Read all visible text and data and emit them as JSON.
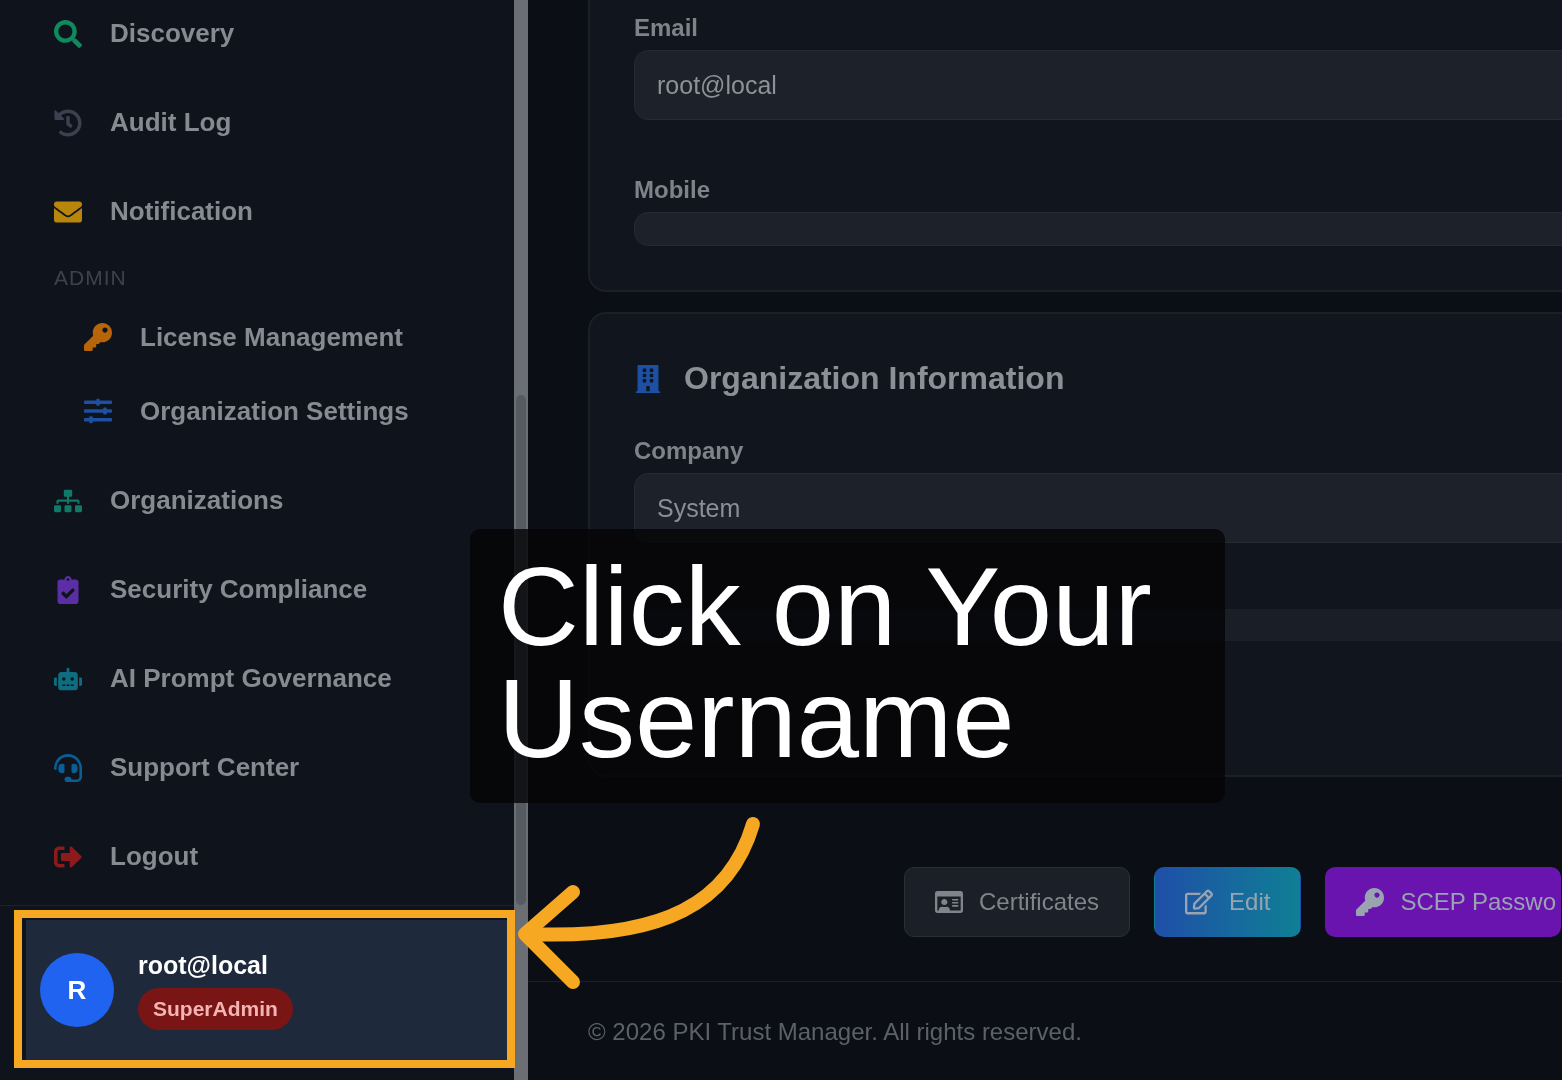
{
  "sidebar": {
    "items": [
      {
        "label": "Discovery",
        "color": "#0f8a5f"
      },
      {
        "label": "Audit Log",
        "color": "#3a4250"
      },
      {
        "label": "Notification",
        "color": "#b8860b"
      }
    ],
    "section": {
      "title": "ADMIN",
      "items": [
        {
          "label": "License Management",
          "color": "#b8650a"
        },
        {
          "label": "Organization Settings",
          "color": "#1d4fa3"
        }
      ]
    },
    "items_after": [
      {
        "label": "Organizations",
        "color": "#0f7a6a"
      },
      {
        "label": "Security Compliance",
        "color": "#5b2ea6"
      },
      {
        "label": "AI Prompt Governance",
        "color": "#0e6e80"
      },
      {
        "label": "Support Center",
        "color": "#0b5e94"
      },
      {
        "label": "Logout",
        "color": "#8e1b1b"
      }
    ],
    "user": {
      "avatar": "R",
      "name": "root@local",
      "role": "SuperAdmin"
    }
  },
  "contact_card": {
    "fields": [
      {
        "label": "Email",
        "value": "root@local"
      },
      {
        "label": "Mobile"
      }
    ]
  },
  "organization_card": {
    "title": "Organization Information",
    "fields": [
      {
        "label": "Company",
        "value": "System"
      }
    ]
  },
  "buttons": [
    {
      "label": "Certificates",
      "kind": "secondary"
    },
    {
      "label": "Edit",
      "kind": "primary"
    },
    {
      "label": "SCEP Passwo",
      "kind": "accent"
    }
  ],
  "footer": "© 2026 PKI Trust Manager. All rights reserved.",
  "annotation": {
    "text": "Click on Your Username"
  }
}
